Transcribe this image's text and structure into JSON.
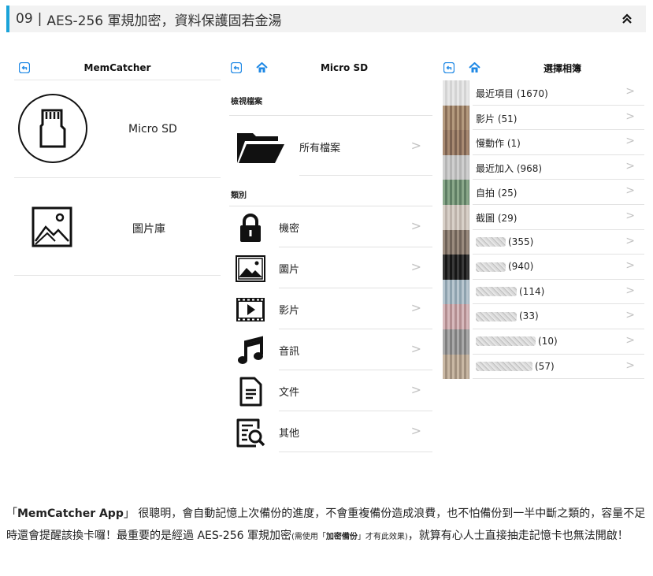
{
  "header": {
    "number": "09",
    "separator": "|",
    "title": "AES-256 軍規加密，資料保護固若金湯"
  },
  "panel_memcatcher": {
    "title": "MemCatcher",
    "items": [
      {
        "label": "Micro SD",
        "icon": "sd-card-icon"
      },
      {
        "label": "圖片庫",
        "icon": "image-icon"
      }
    ]
  },
  "panel_microsd": {
    "title": "Micro SD",
    "section_view": "檢視檔案",
    "all_files": "所有檔案",
    "section_category": "類別",
    "categories": [
      {
        "label": "機密",
        "icon": "lock-icon"
      },
      {
        "label": "圖片",
        "icon": "picture-icon"
      },
      {
        "label": "影片",
        "icon": "video-icon"
      },
      {
        "label": "音訊",
        "icon": "music-note-icon"
      },
      {
        "label": "文件",
        "icon": "document-icon"
      },
      {
        "label": "其他",
        "icon": "search-document-icon"
      }
    ],
    "chevron": ">"
  },
  "panel_albums": {
    "title": "選擇相簿",
    "albums": [
      {
        "name": "最近項目",
        "count": "(1670)"
      },
      {
        "name": "影片",
        "count": "(51)"
      },
      {
        "name": "慢動作",
        "count": "(1)"
      },
      {
        "name": "最近加入",
        "count": "(968)"
      },
      {
        "name": "自拍",
        "count": "(25)"
      },
      {
        "name": "截圖",
        "count": "(29)"
      },
      {
        "name": "",
        "count": "(355)"
      },
      {
        "name": "",
        "count": "(940)"
      },
      {
        "name": "",
        "count": "(114)"
      },
      {
        "name": "",
        "count": "(33)"
      },
      {
        "name": "",
        "count": "(10)"
      },
      {
        "name": "",
        "count": "(57)"
      }
    ]
  },
  "article": {
    "open_quote": "「",
    "app_name": "MemCatcher App",
    "close_quote": "」",
    "text_1": "很聰明，會自動記憶上次備份的進度，不會重複備份造成浪費，也不怕備份到一半中斷之類的，容量不足時還會提醒該換卡囉！最重要的是經過 AES-256 軍規加密",
    "note_1": "(需使用「",
    "note_bold": "加密備份",
    "note_2": "」才有此效果)",
    "text_2": "，就算有心人士直接抽走記憶卡也無法開啟！"
  },
  "colors": {
    "accent": "#1aa3d9",
    "nav_icon": "#1e88e5",
    "header_bg": "#f2f2f2"
  }
}
